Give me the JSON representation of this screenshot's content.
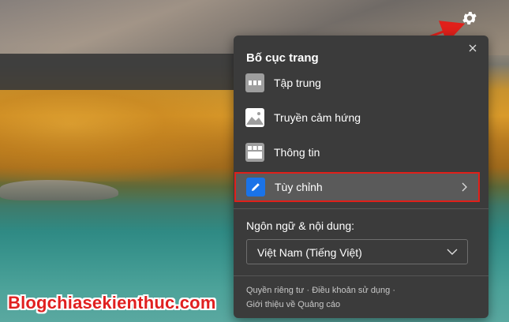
{
  "panel": {
    "title": "Bố cục trang",
    "items": [
      {
        "label": "Tập trung",
        "icon": "focused-layout-icon"
      },
      {
        "label": "Truyền cảm hứng",
        "icon": "inspirational-layout-icon"
      },
      {
        "label": "Thông tin",
        "icon": "informational-layout-icon"
      },
      {
        "label": "Tùy chỉnh",
        "icon": "pencil-icon",
        "selected": true
      }
    ],
    "language_label": "Ngôn ngữ & nội dung:",
    "language_value": "Việt Nam (Tiếng Việt)",
    "footer": {
      "privacy": "Quyền riêng tư",
      "sep1": " · ",
      "terms": "Điều khoản sử dụng",
      "sep2": " ·",
      "ads": "Giới thiệu về Quảng cáo"
    }
  },
  "watermark": "Blogchiasekienthuc.com",
  "colors": {
    "panel_bg": "#3b3b3b",
    "highlight_border": "#e0201a",
    "accent": "#1a73e8",
    "arrow": "#e0201a"
  }
}
